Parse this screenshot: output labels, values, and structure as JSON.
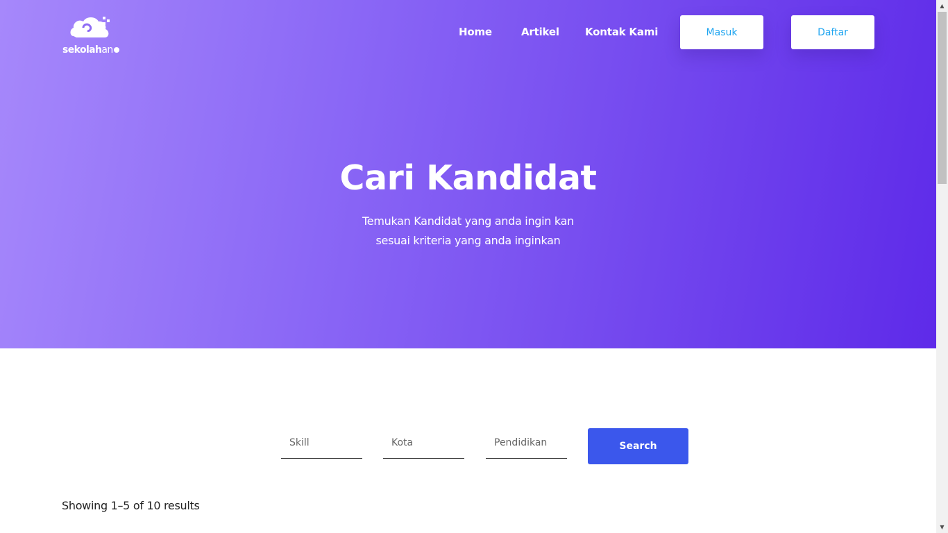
{
  "brand": {
    "logo_text_bold": "sekolah",
    "logo_text_light": "an",
    "logo_icon": "elephant-cloud-icon"
  },
  "nav": {
    "links": [
      "Home",
      "Artikel",
      "Kontak Kami"
    ],
    "login_label": "Masuk",
    "register_label": "Daftar"
  },
  "hero": {
    "title": "Cari Kandidat",
    "subtitle_line1": "Temukan Kandidat yang anda ingin kan",
    "subtitle_line2": "sesuai kriteria yang anda inginkan"
  },
  "search": {
    "skill_placeholder": "Skill",
    "city_placeholder": "Kota",
    "education_placeholder": "Pendidikan",
    "button_label": "Search"
  },
  "results": {
    "summary": "Showing 1–5 of 10 results"
  },
  "colors": {
    "hero_gradient_start": "#a688fb",
    "hero_gradient_end": "#5e2ae9",
    "search_button": "#3b57ec",
    "nav_button_text": "#1fa5f0"
  }
}
